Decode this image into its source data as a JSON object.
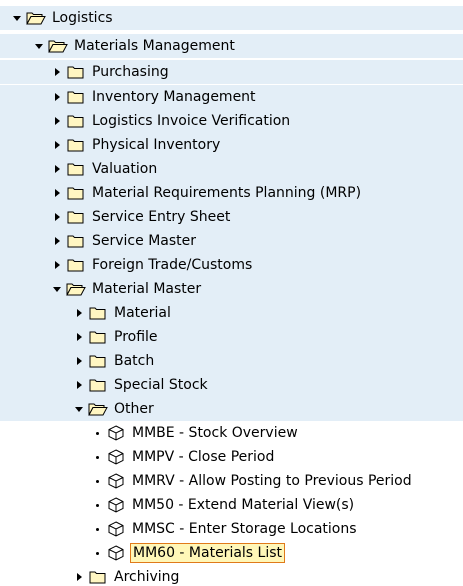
{
  "tree": {
    "logistics": "Logistics",
    "materials_management": "Materials Management",
    "purchasing": "Purchasing",
    "inventory_management": "Inventory Management",
    "logistics_invoice_verification": "Logistics Invoice Verification",
    "physical_inventory": "Physical Inventory",
    "valuation": "Valuation",
    "mrp": "Material Requirements Planning (MRP)",
    "service_entry_sheet": "Service Entry Sheet",
    "service_master": "Service Master",
    "foreign_trade": "Foreign Trade/Customs",
    "material_master": "Material Master",
    "material": "Material",
    "profile": "Profile",
    "batch": "Batch",
    "special_stock": "Special Stock",
    "other": "Other",
    "mmbe": "MMBE - Stock Overview",
    "mmpv": "MMPV - Close Period",
    "mmrv": "MMRV - Allow Posting to Previous Period",
    "mm50": "MM50 - Extend Material View(s)",
    "mmsc": "MMSC - Enter Storage Locations",
    "mm60": "MM60 - Materials List",
    "archiving": "Archiving"
  },
  "icons": {
    "folder_closed": "folder-icon",
    "folder_open": "folder-open-icon",
    "transaction": "transaction-cube-icon"
  },
  "colors": {
    "row_background": "#e3eef7",
    "folder_fill": "#fff6c2",
    "highlight_background": "#fff7b8",
    "highlight_border": "#e07a1a"
  }
}
